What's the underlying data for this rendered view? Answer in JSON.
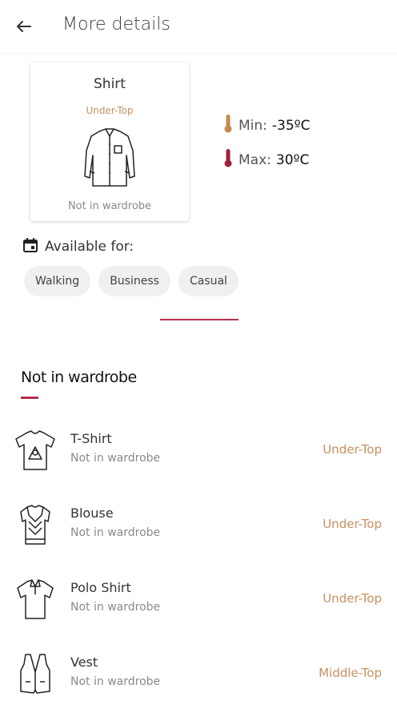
{
  "header": {
    "title": "More details"
  },
  "item": {
    "name": "Shirt",
    "category": "Under-Top",
    "status": "Not in wardrobe",
    "icon": "shirt-icon"
  },
  "temperature": {
    "min_label": "Min:",
    "min_value": "-35ºC",
    "max_label": "Max:",
    "max_value": "30ºC",
    "min_color": "#c48a4a",
    "max_color": "#a0203a"
  },
  "available": {
    "label": "Available for:",
    "chips": [
      "Walking",
      "Business",
      "Casual"
    ]
  },
  "section": {
    "title": "Not in wardrobe"
  },
  "list": [
    {
      "name": "T-Shirt",
      "status": "Not in wardrobe",
      "category": "Under-Top",
      "icon": "tshirt-icon"
    },
    {
      "name": "Blouse",
      "status": "Not in wardrobe",
      "category": "Under-Top",
      "icon": "blouse-icon"
    },
    {
      "name": "Polo Shirt",
      "status": "Not in wardrobe",
      "category": "Under-Top",
      "icon": "polo-shirt-icon"
    },
    {
      "name": "Vest",
      "status": "Not in wardrobe",
      "category": "Middle-Top",
      "icon": "vest-icon"
    }
  ],
  "colors": {
    "accent": "#b3304a",
    "category": "#c79060"
  }
}
